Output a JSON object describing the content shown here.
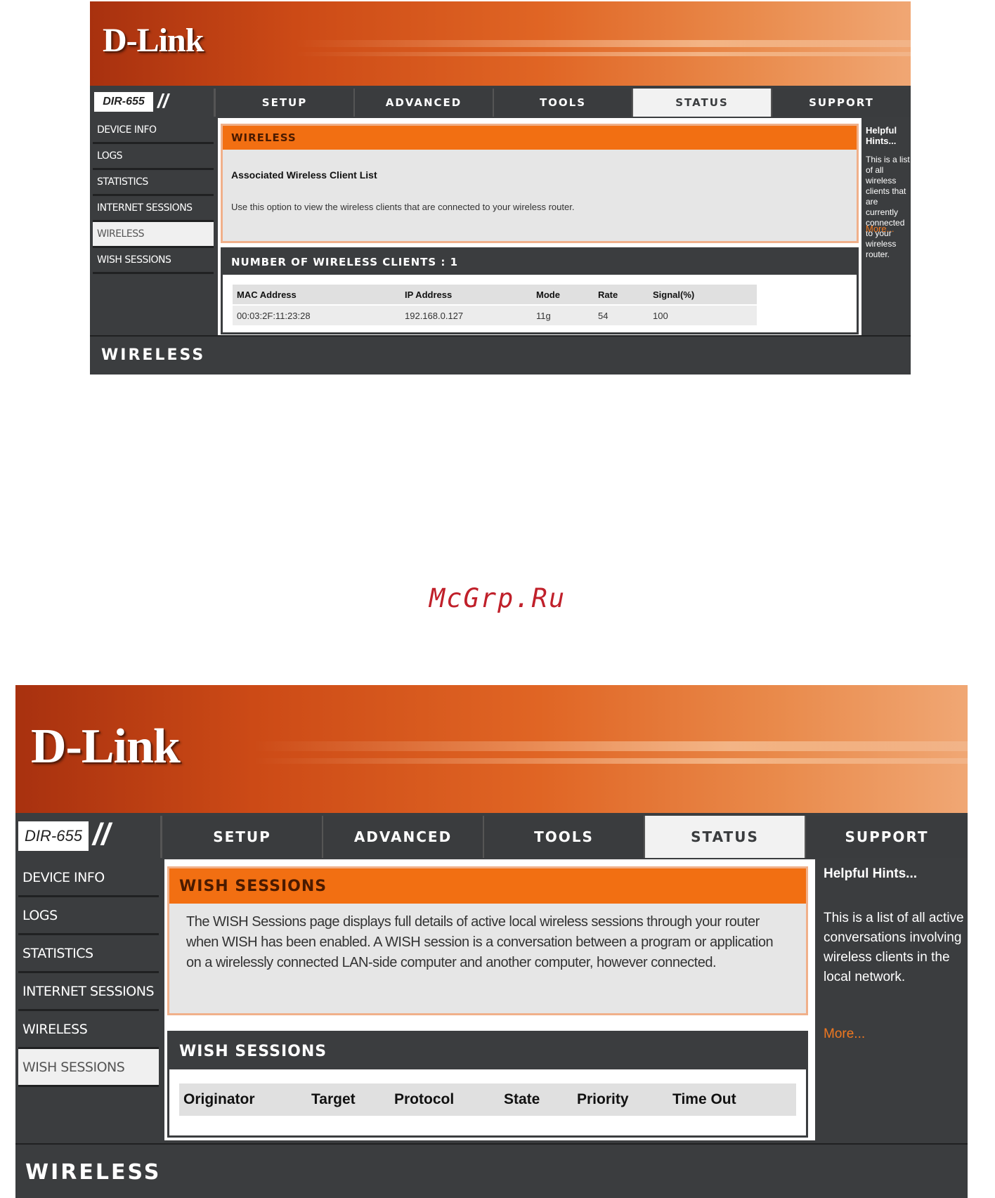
{
  "screen1": {
    "brand": "D-Link",
    "model": "DIR-655",
    "tabs": [
      "SETUP",
      "ADVANCED",
      "TOOLS",
      "STATUS",
      "SUPPORT"
    ],
    "active_tab": "STATUS",
    "sidebar": [
      "DEVICE INFO",
      "LOGS",
      "STATISTICS",
      "INTERNET SESSIONS",
      "WIRELESS",
      "WISH SESSIONS"
    ],
    "active_sidebar": "WIRELESS",
    "section_title": "WIRELESS",
    "subtitle": "Associated Wireless Client List",
    "description": "Use this option to view the wireless clients that are connected to your wireless router.",
    "clients_header": "NUMBER OF WIRELESS CLIENTS : 1",
    "table": {
      "columns": [
        "MAC Address",
        "IP Address",
        "Mode",
        "Rate",
        "Signal(%)"
      ],
      "rows": [
        [
          "00:03:2F:11:23:28",
          "192.168.0.127",
          "11g",
          "54",
          "100"
        ]
      ]
    },
    "hints_title": "Helpful Hints...",
    "hints_text": "This is a list of all wireless clients that are currently connected to your wireless router.",
    "hints_more": "More...",
    "footer": "WIRELESS"
  },
  "watermark": "McGrp.Ru",
  "screen2": {
    "brand": "D-Link",
    "model": "DIR-655",
    "tabs": [
      "SETUP",
      "ADVANCED",
      "TOOLS",
      "STATUS",
      "SUPPORT"
    ],
    "active_tab": "STATUS",
    "sidebar": [
      "DEVICE INFO",
      "LOGS",
      "STATISTICS",
      "INTERNET SESSIONS",
      "WIRELESS",
      "WISH SESSIONS"
    ],
    "active_sidebar": "WISH SESSIONS",
    "section_title": "WISH SESSIONS",
    "description": "The WISH Sessions page displays full details of active local wireless sessions through your router when WISH has been enabled. A WISH session is a conversation between a program or application on a wirelessly connected LAN-side computer and another computer, however connected.",
    "sessions_header": "WISH SESSIONS",
    "table": {
      "columns": [
        "Originator",
        "Target",
        "Protocol",
        "State",
        "Priority",
        "Time Out"
      ]
    },
    "hints_title": "Helpful Hints...",
    "hints_text": "This is a list of all active conversations involving wireless clients in the local network.",
    "hints_more": "More...",
    "footer": "WIRELESS"
  }
}
